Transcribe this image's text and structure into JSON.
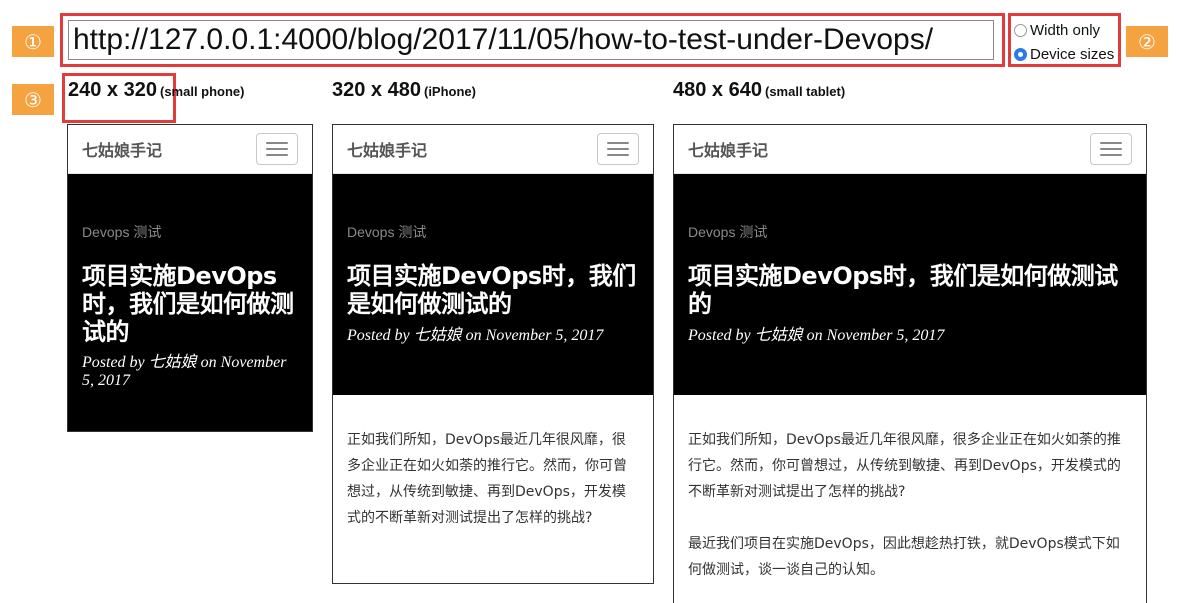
{
  "markers": [
    "①",
    "②",
    "③"
  ],
  "url_bar": {
    "value": "http://127.0.0.1:4000/blog/2017/11/05/how-to-test-under-Devops/"
  },
  "size_mode": {
    "options": [
      {
        "label": "Width only",
        "checked": false
      },
      {
        "label": "Device sizes",
        "checked": true
      }
    ]
  },
  "devices": [
    {
      "size": "240 x 320",
      "name": "(small phone)"
    },
    {
      "size": "320 x 480",
      "name": "(iPhone)"
    },
    {
      "size": "480 x 640",
      "name": "(small tablet)"
    }
  ],
  "blog": {
    "brand": "七姑娘手记",
    "tag": "Devops 测试",
    "title": "项目实施DevOps时，我们是如何做测试的",
    "posted_by": "Posted by",
    "author": "七姑娘",
    "on": "on",
    "date": "November 5, 2017",
    "paragraphs": [
      "正如我们所知，DevOps最近几年很风靡，很多企业正在如火如荼的推行它。然而，你可曾想过，从传统到敏捷、再到DevOps，开发模式的不断革新对测试提出了怎样的挑战?",
      "最近我们项目在实施DevOps，因此想趁热打铁，就DevOps模式下如何做测试，谈一谈自己的认知。"
    ]
  },
  "colors": {
    "marker": "#f5a340",
    "highlight": "#e23b3b",
    "radio_selected": "#2a7be4",
    "hero_bg": "#000000"
  }
}
